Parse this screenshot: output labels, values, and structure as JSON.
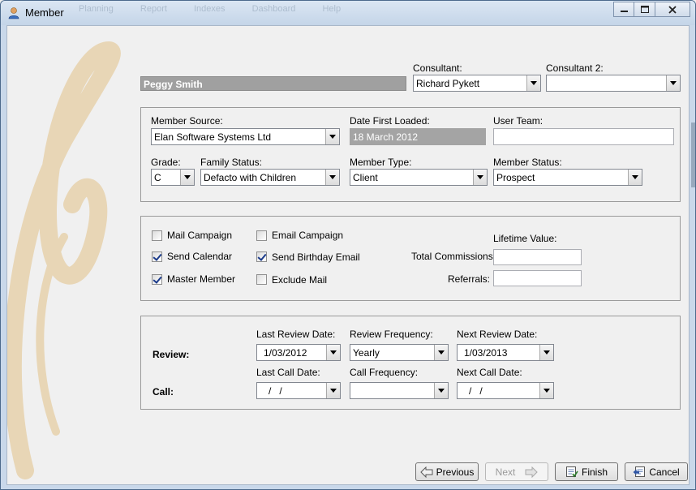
{
  "window": {
    "title": "Member",
    "ghost_menu": [
      "Planning",
      "Report",
      "Indexes",
      "Dashboard",
      "Help"
    ]
  },
  "header": {
    "member_name": "Peggy Smith",
    "consultant_label": "Consultant:",
    "consultant_value": "Richard Pykett",
    "consultant2_label": "Consultant 2:",
    "consultant2_value": ""
  },
  "details": {
    "member_source_label": "Member Source:",
    "member_source_value": "Elan Software Systems Ltd",
    "date_first_loaded_label": "Date First Loaded:",
    "date_first_loaded_value": "18 March 2012",
    "user_team_label": "User Team:",
    "user_team_value": "",
    "grade_label": "Grade:",
    "grade_value": "C",
    "family_status_label": "Family Status:",
    "family_status_value": "Defacto with Children",
    "member_type_label": "Member Type:",
    "member_type_value": "Client",
    "member_status_label": "Member Status:",
    "member_status_value": "Prospect"
  },
  "flags": {
    "mail_campaign": {
      "label": "Mail Campaign",
      "checked": false
    },
    "send_calendar": {
      "label": "Send Calendar",
      "checked": true
    },
    "master_member": {
      "label": "Master Member",
      "checked": true
    },
    "email_campaign": {
      "label": "Email Campaign",
      "checked": false
    },
    "send_birthday_email": {
      "label": "Send Birthday Email",
      "checked": true
    },
    "exclude_mail": {
      "label": "Exclude Mail",
      "checked": false
    },
    "lifetime_value_label": "Lifetime Value:",
    "total_commissions_label": "Total Commissions:",
    "total_commissions_value": "",
    "referrals_label": "Referrals:",
    "referrals_value": ""
  },
  "review": {
    "review_label": "Review:",
    "call_label": "Call:",
    "last_review_date_label": "Last Review Date:",
    "last_review_date_value": "1/03/2012",
    "review_frequency_label": "Review Frequency:",
    "review_frequency_value": "Yearly",
    "next_review_date_label": "Next Review Date:",
    "next_review_date_value": "1/03/2013",
    "last_call_date_label": "Last Call Date:",
    "last_call_date_value": "/   /",
    "call_frequency_label": "Call Frequency:",
    "call_frequency_value": "",
    "next_call_date_label": "Next Call Date:",
    "next_call_date_value": "/   /"
  },
  "footer": {
    "previous": "Previous",
    "next": "Next",
    "finish": "Finish",
    "cancel": "Cancel"
  },
  "colors": {
    "swirl": "#e8d6b6",
    "disabled_field": "#a4a4a4"
  }
}
